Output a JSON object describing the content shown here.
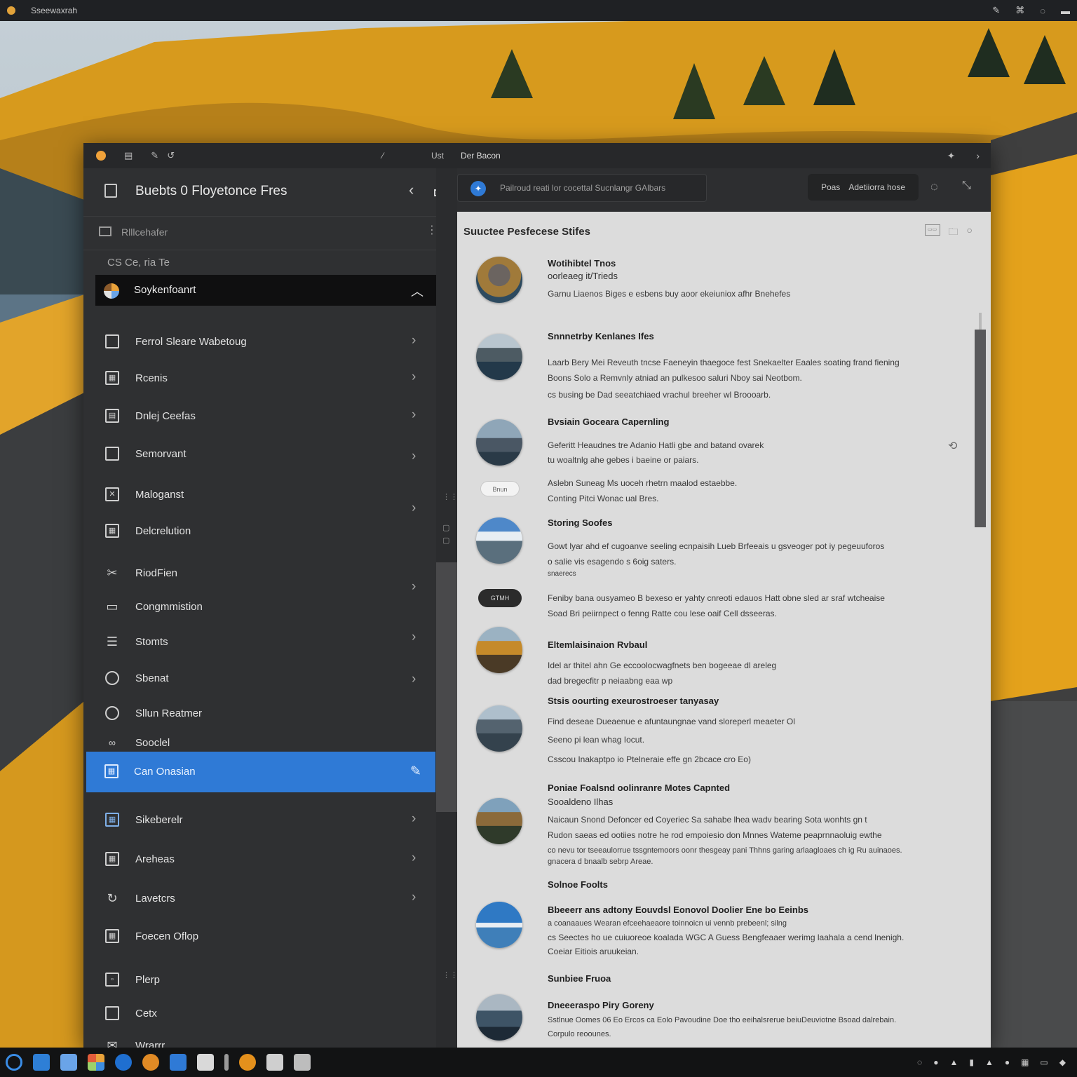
{
  "os": {
    "app_name": "Sseewaxrah",
    "tray_icons": [
      "pen-icon",
      "gamepad-icon",
      "refresh-icon",
      "minimize-icon"
    ]
  },
  "window": {
    "titlebar": {
      "icons": [
        "dot-icon",
        "image-icon",
        "edit-icon",
        "undo-icon"
      ],
      "mid": "Ust",
      "title": "Der Bacon"
    },
    "sidebar": {
      "title": "Buebts 0 Floyetonce Fres",
      "sub_label": "Rlllcehafer",
      "filter_label": "CS  Ce, ria Te",
      "selected_label": "Soykenfoanrt",
      "items": [
        {
          "label": "Ferrol Sleare Wabetoug",
          "icon": "square-icon",
          "chevron": true
        },
        {
          "label": "Rcenis",
          "icon": "grid-icon",
          "chevron": true
        },
        {
          "label": "Dnlej Ceefas",
          "icon": "table-icon",
          "chevron": true
        },
        {
          "label": "Semorvant",
          "icon": "window-icon",
          "chevron": true
        },
        {
          "label": "Maloganst",
          "icon": "close-box-icon",
          "chevron": true
        },
        {
          "label": "Delcrelution",
          "icon": "calendar-icon",
          "chevron": false
        },
        {
          "label": "RiodFien",
          "icon": "tools-icon",
          "chevron": true
        },
        {
          "label": "Congmmistion",
          "icon": "chat-icon",
          "chevron": false
        },
        {
          "label": "Stomts",
          "icon": "list-icon",
          "chevron": true
        },
        {
          "label": "Sbenat",
          "icon": "inbox-icon",
          "chevron": true
        },
        {
          "label": "Sllun Reatmer",
          "icon": "circle-icon",
          "chevron": false
        },
        {
          "label": "Sooclel",
          "icon": "link-icon",
          "chevron": false
        },
        {
          "label": "Can Onasian",
          "icon": "calendar-icon",
          "chevron": false,
          "active": true
        },
        {
          "label": "Sikeberelr",
          "icon": "calendar-icon",
          "chevron": true
        },
        {
          "label": "Areheas",
          "icon": "calendar-icon",
          "chevron": true
        },
        {
          "label": "Lavetcrs",
          "icon": "rotate-icon",
          "chevron": true
        },
        {
          "label": "Foecen Oflop",
          "icon": "calendar-icon",
          "chevron": false
        },
        {
          "label": "Plerp",
          "icon": "square-icon",
          "chevron": false
        },
        {
          "label": "Cetx",
          "icon": "square-icon",
          "chevron": false
        },
        {
          "label": "Wrarrr",
          "icon": "bell-icon",
          "chevron": false
        }
      ]
    },
    "topbar": {
      "search_placeholder": "Pailroud reati lor cocettal Sucnlangr GAlbars",
      "pill_left": "Poas",
      "pill_right": "Adetiiorra hose"
    },
    "content": {
      "title": "Suuctee Pesfecese Stifes",
      "rows": [
        {
          "title": "Wotihibtel Tnos",
          "subtitle": "oorleaeg it/Trieds",
          "desc": [
            "Garnu Liaenos Biges e esbens buy aoor ekeiuniox afhr Bnehefes"
          ],
          "thumb": "mountain-thumb"
        },
        {
          "title": "Snnnetrby Kenlanes Ifes",
          "subtitle": "",
          "desc": [
            "Laarb Bery Mei Reveuth tncse Faeneyin thaegoce fest Snekaelter Eaales soating frand fiening",
            "Boons Solo a Remvnly atniad an pulkesoo saluri Nboy sai Neotbom.",
            "cs busing be Dad seeatchiaed vrachul breeher wl Broooarb."
          ],
          "thumb": "lake-thumb"
        },
        {
          "title": "Bvsiain Goceara Capernling",
          "subtitle": "",
          "desc": [
            "Geferitt Heaudnes tre Adanio Hatli gbe and batand ovarek",
            "tu woaltnlg ahe gebes i baeine or paiars.",
            "",
            "Aslebn Suneag Ms uoceh rhetrn maalod estaebbe.",
            "Conting Pitci Wonac ual Bres."
          ],
          "thumb": "peak-thumb",
          "badge": "Bnun",
          "side_icon": "search-refresh-icon"
        },
        {
          "title": "Storing Soofes",
          "subtitle": "",
          "desc": [
            "Gowt lyar ahd ef cugoanve seeling ecnpaisih Lueb Brfeeais u gsveoger pot iy pegeuuforos",
            "o salie vis esagendo s 6oig saters.",
            "snaerecs",
            "",
            "Feniby bana ousyameo B bexeso er yahty cnreoti edauos Hatt obne sled ar sraf wtcheaise",
            "Soad Bri peiirnpect o fenng Ratte cou lese oaif Cell dsseeras."
          ],
          "thumb": "snowpeak-thumb",
          "badge": "GTMH"
        },
        {
          "title": "Eltemlaisinaion Rvbaul",
          "subtitle": "",
          "desc": [
            "Idel ar thitel ahn Ge eccoolocwagfnets ben bogeeae dl areleg",
            "dad bregecfitr p neiaabng eaa wp"
          ],
          "thumb": "sunset-thumb"
        },
        {
          "title": "Stsis oourting exeurostroeser tanyasay",
          "subtitle": "",
          "desc": [
            "Find deseae Dueaenue e afuntaungnae vand sloreperl meaeter Ol",
            "Seeno pi lean whag Iocut.",
            "Csscou Inakaptpo io Ptelneraie effe gn 2bcace cro Eo)"
          ],
          "thumb": "range-thumb"
        },
        {
          "title": "Poniae Foalsnd oolinranre Motes Capnted",
          "subtitle": "Sooaldeno Ilhas",
          "desc": [
            "Naicaun Snond Defoncer ed Coyeriec Sa sahabe lhea wadv bearing Sota wonhts gn t",
            "Rudon saeas ed ootiies notre he rod empoiesio don Mnnes Wateme peaprnnaoluig ewthe",
            "co nevu tor tseeaulorrue tssgntemoors oonr thesgeay pani Thhns garing arlaagloaes ch ig Ru auinaoes.",
            "gnacera d bnaalb sebrp Areae."
          ],
          "thumb": "summit-thumb"
        },
        {
          "title": "Solnoe Foolts",
          "subtitle": "",
          "desc": [],
          "thumb": "",
          "header_only": true
        },
        {
          "title": "Bbeeerr ans adtony Eouvdsl Eonovol Doolier Ene bo Eeinbs",
          "subtitle": "",
          "desc": [
            "a coanaaues Wearan efceehaeaore toinnoicn ui vennb prebeenl; silng",
            "cs Seectes ho ue cuiuoreoe koalada WGC A Guess Bengfeaaer werimg laahala a cend lnenigh.",
            "Coeiar Eitiois aruukeian."
          ],
          "thumb": "glacier-thumb"
        },
        {
          "title": "Sunbiee Fruoa",
          "subtitle": "",
          "desc": [],
          "thumb": "",
          "header_only": true
        },
        {
          "title": "Dneeeraspo Piry Goreny",
          "subtitle": "",
          "desc": [
            "Sstlnue Oomes 06 Eo Ercos ca Eolo Pavoudine Doe tho eeihalsrerue beiuDeuviotne Bsoad dalrebain.",
            "Corpulo reoounes."
          ],
          "thumb": "valley-thumb"
        }
      ]
    }
  },
  "taskbar": {
    "apps": [
      "start-icon",
      "explorer-icon",
      "desktop-icon",
      "store-icon",
      "browser-icon",
      "firefox-icon",
      "app-icon",
      "mail-icon",
      "menu-icon",
      "media-icon",
      "files-icon",
      "calculator-icon"
    ],
    "tray": [
      "network-icon",
      "cloud-icon",
      "volume-icon",
      "battery-icon",
      "wifi-icon",
      "user-icon",
      "grid-icon",
      "chat-icon",
      "notifications-icon"
    ]
  },
  "colors": {
    "accent": "#2f7ad6",
    "panel_dark": "#2f3032",
    "content_bg": "#dcdcdc",
    "titlebar_dot": "#f0a23a"
  }
}
